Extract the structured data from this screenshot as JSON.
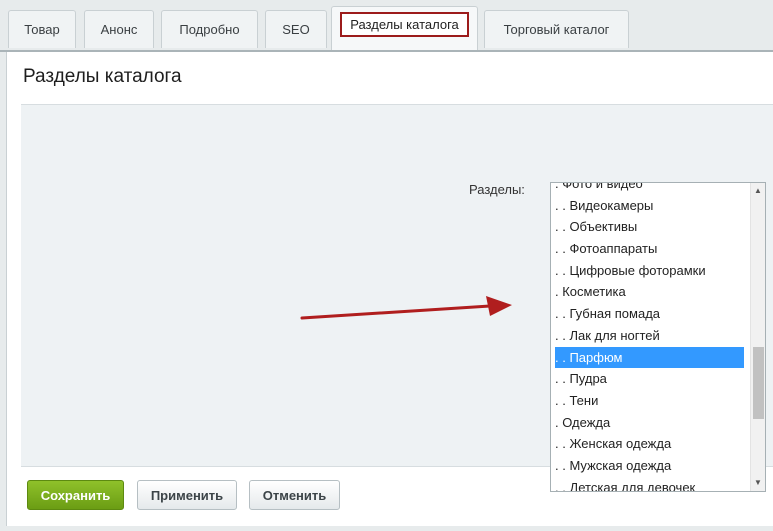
{
  "tabs": [
    {
      "label": "Товар"
    },
    {
      "label": "Анонс"
    },
    {
      "label": "Подробно"
    },
    {
      "label": "SEO"
    },
    {
      "label": "Разделы каталога",
      "active": true
    },
    {
      "label": "Торговый каталог"
    }
  ],
  "panel": {
    "title": "Разделы каталога",
    "field_label": "Разделы:"
  },
  "sections_list": {
    "items": [
      ". Фото и видео",
      ". . Видеокамеры",
      ". . Объективы",
      ". . Фотоаппараты",
      ". . Цифровые фоторамки",
      ". Косметика",
      ". . Губная помада",
      ". . Лак для ногтей",
      ". . Парфюм",
      ". . Пудра",
      ". . Тени",
      ". Одежда",
      ". . Женская одежда",
      ". . Мужская одежда",
      ". . Детская для девочек"
    ],
    "selected": ". . Парфюм"
  },
  "buttons": {
    "save": "Сохранить",
    "apply": "Применить",
    "cancel": "Отменить"
  },
  "colors": {
    "accent_selected": "#3399ff",
    "save_button": "#7aac1b",
    "annotation_arrow": "#b01e1e",
    "active_tab_outline": "#9c1b1b"
  }
}
